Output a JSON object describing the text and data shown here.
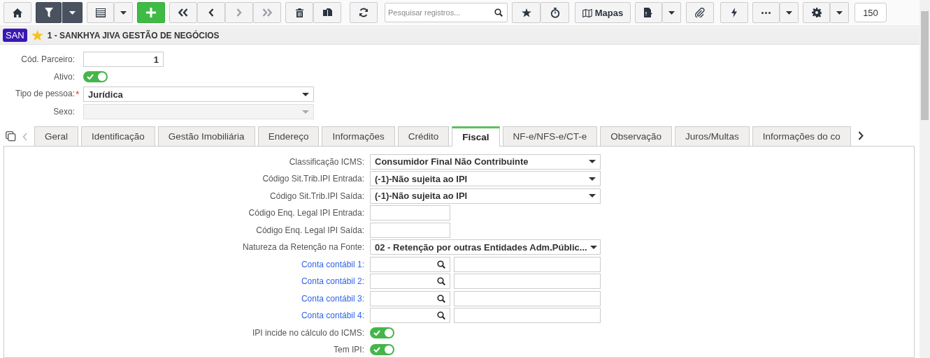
{
  "toolbar": {
    "search": {
      "placeholder": "Pesquisar registros..."
    },
    "maps_button": "Mapas",
    "page_size": "150"
  },
  "title_bar": {
    "badge": "SAN",
    "favorite": true,
    "title": "1 - SANKHYA JIVA GESTÃO DE NEGÓCIOS"
  },
  "header_fields": [
    {
      "kind": "text",
      "label": "Cód. Parceiro:",
      "value": "1"
    },
    {
      "kind": "toggle",
      "label": "Ativo:",
      "on": true
    },
    {
      "kind": "select",
      "label": "Tipo de pessoa:",
      "required_mark": "*",
      "value": "Jurídica",
      "disabled": false
    },
    {
      "kind": "select",
      "label": "Sexo:",
      "disabled": true
    }
  ],
  "tabs": [
    {
      "label": "Geral",
      "selected": false
    },
    {
      "label": "Identificação",
      "selected": false
    },
    {
      "label": "Gestão Imobiliária",
      "selected": false
    },
    {
      "label": "Endereço",
      "selected": false
    },
    {
      "label": "Informações",
      "selected": false
    },
    {
      "label": "Crédito",
      "selected": false
    },
    {
      "label": "Fiscal",
      "selected": true
    },
    {
      "label": "NF-e/NFS-e/CT-e",
      "selected": false
    },
    {
      "label": "Observação",
      "selected": false
    },
    {
      "label": "Juros/Multas",
      "selected": false
    },
    {
      "label": "Informações do co",
      "selected": false
    }
  ],
  "fiscal_fields": [
    {
      "kind": "select",
      "label": "Classificação ICMS:",
      "value": "Consumidor Final Não Contribuinte"
    },
    {
      "kind": "select",
      "label": "Código Sit.Trib.IPI Entrada:",
      "value": "(-1)-Não sujeita ao IPI"
    },
    {
      "kind": "select",
      "label": "Código Sit.Trib.IPI Saída:",
      "value": "(-1)-Não sujeita ao IPI"
    },
    {
      "kind": "text",
      "label": "Código Enq. Legal IPI Entrada:"
    },
    {
      "kind": "text",
      "label": "Código Enq. Legal IPI Saída:"
    },
    {
      "kind": "select",
      "label": "Natureza da Retenção na Fonte:",
      "value": "02 - Retenção por outras Entidades Adm.Públic..."
    },
    {
      "kind": "lookup",
      "label": "Conta contábil 1:"
    },
    {
      "kind": "lookup",
      "label": "Conta contábil 2:"
    },
    {
      "kind": "lookup",
      "label": "Conta contábil 3:"
    },
    {
      "kind": "lookup",
      "label": "Conta contábil 4:"
    },
    {
      "kind": "toggle",
      "label": "IPI incide no cálculo do ICMS:",
      "on": true
    },
    {
      "kind": "toggle",
      "label": "Tem IPI:",
      "on": true
    }
  ]
}
